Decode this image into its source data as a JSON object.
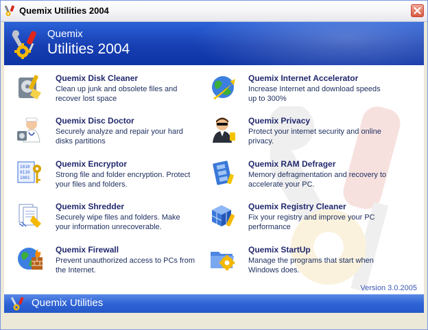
{
  "window": {
    "title": "Quemix Utilities 2004"
  },
  "banner": {
    "brand_line1": "Quemix",
    "brand_line2": "Utilities 2004"
  },
  "items": [
    {
      "name": "Quemix Disk Cleaner",
      "desc": "Clean up junk and obsolete files and recover lost space",
      "icon": "disk-cleaner-icon"
    },
    {
      "name": "Quemix Internet Accelerator",
      "desc": "Increase Internet and download speeds up to 300%",
      "icon": "globe-icon"
    },
    {
      "name": "Quemix Disc Doctor",
      "desc": "Securely analyze and repair your hard disks partitions",
      "icon": "doctor-icon"
    },
    {
      "name": "Quemix Privacy",
      "desc": "Protect your internet security and online privacy.",
      "icon": "agent-icon"
    },
    {
      "name": "Quemix Encryptor",
      "desc": "Strong file and folder encryption. Protect your files and folders.",
      "icon": "key-icon"
    },
    {
      "name": "Quemix RAM Defrager",
      "desc": "Memory defragmentation and recovery to accelerate your PC.",
      "icon": "memory-icon"
    },
    {
      "name": "Quemix Shredder",
      "desc": "Securely wipe files and folders. Make your information unrecoverable.",
      "icon": "shredder-icon"
    },
    {
      "name": "Quemix Registry Cleaner",
      "desc": "Fix your registry and improve your PC performance",
      "icon": "registry-cube-icon"
    },
    {
      "name": "Quemix Firewall",
      "desc": "Prevent unauthorized access to PCs from the Internet.",
      "icon": "firewall-icon"
    },
    {
      "name": "Quemix StartUp",
      "desc": "Manage the programs that start when Windows does.",
      "icon": "startup-folder-icon"
    }
  ],
  "version": "Version 3.0.2005",
  "footer": {
    "brand_a": "Quemix",
    "brand_b": "Utilities"
  },
  "colors": {
    "banner": "#1a45b8",
    "item_title": "#22286e",
    "version": "#3a57b6"
  }
}
